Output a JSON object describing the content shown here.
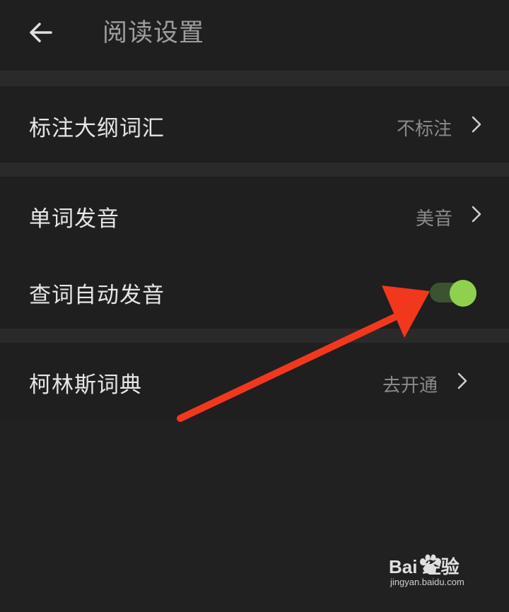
{
  "header": {
    "title": "阅读设置",
    "back_icon": "back-arrow-icon"
  },
  "settings": {
    "outline_vocab": {
      "label": "标注大纲词汇",
      "value": "不标注"
    },
    "pronunciation": {
      "label": "单词发音",
      "value": "美音"
    },
    "auto_pronounce": {
      "label": "查词自动发音",
      "enabled": true
    },
    "collins": {
      "label": "柯林斯词典",
      "value": "去开通"
    }
  },
  "watermark": {
    "brand": "Bai 经验",
    "url": "jingyan.baidu.com"
  },
  "colors": {
    "background": "#212121",
    "toggle_knob": "#8fd14f",
    "toggle_track": "#3b5331",
    "annotation_arrow": "#f2381c"
  }
}
